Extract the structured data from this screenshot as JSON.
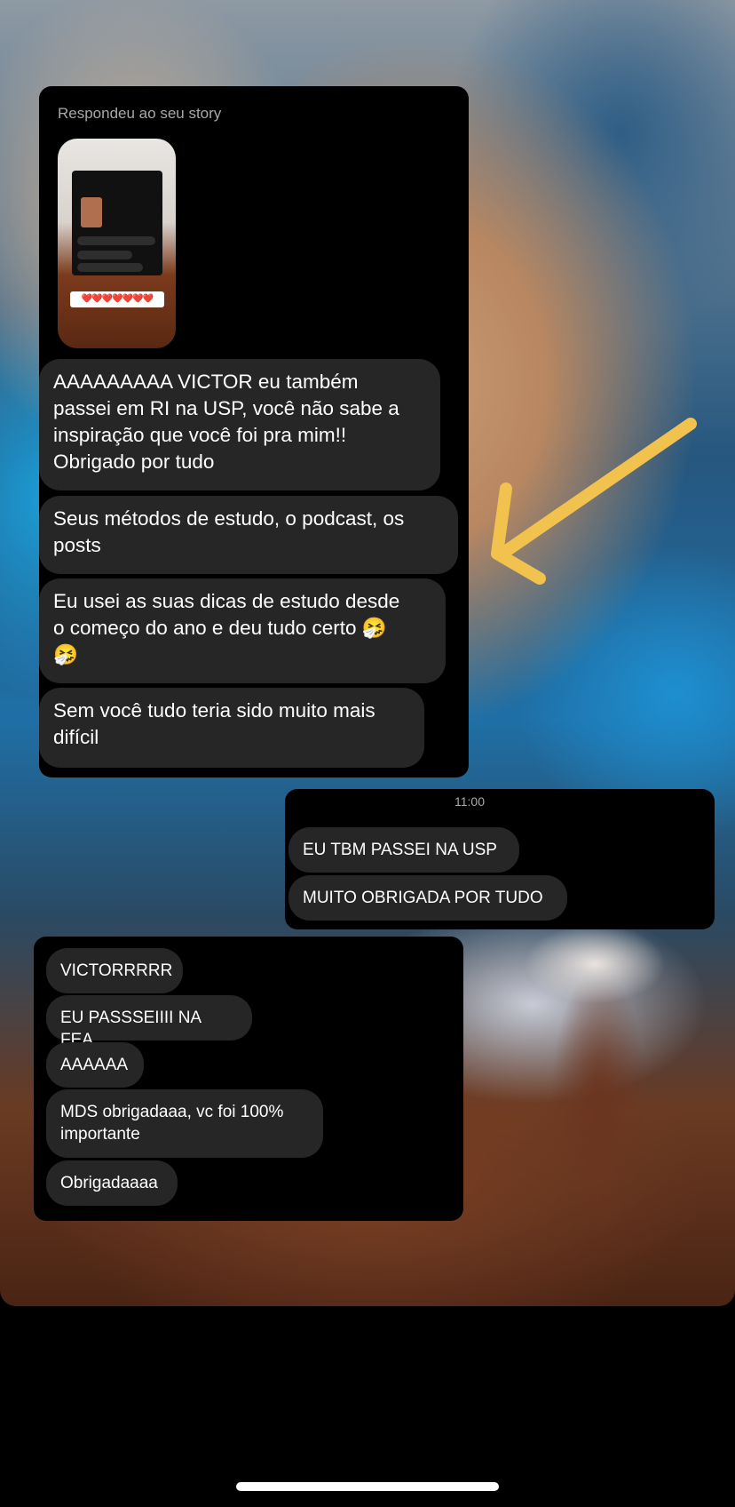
{
  "story": {
    "reply_label": "Respondeu ao seu story",
    "thumb_hearts": "❤️❤️❤️❤️❤️❤️❤️"
  },
  "messages_received_1": [
    "AAAAAAAAA VICTOR eu também\npassei em RI na USP, você não sabe a\ninspiração que você foi pra mim!!\nObrigado por tudo",
    "Seus métodos de estudo, o podcast, os\nposts",
    "Eu usei as suas dicas de estudo desde\no começo do ano e deu tudo certo 🤧\n🤧",
    "Sem você tudo teria sido muito mais\ndifícil"
  ],
  "sent": {
    "time": "11:00",
    "messages": [
      "EU TBM PASSEI NA USP",
      "MUITO OBRIGADA POR TUDO"
    ]
  },
  "messages_received_2": [
    "VICTORRRRR",
    "EU PASSSEIIII NA FEA",
    "AAAAAA",
    "MDS obrigadaaa, vc foi 100%\nimportante",
    "Obrigadaaaa"
  ],
  "colors": {
    "bubble": "#262626",
    "panel": "#000000",
    "arrow": "#f2c24f"
  },
  "icons": [
    "arrow-annotation-icon"
  ]
}
